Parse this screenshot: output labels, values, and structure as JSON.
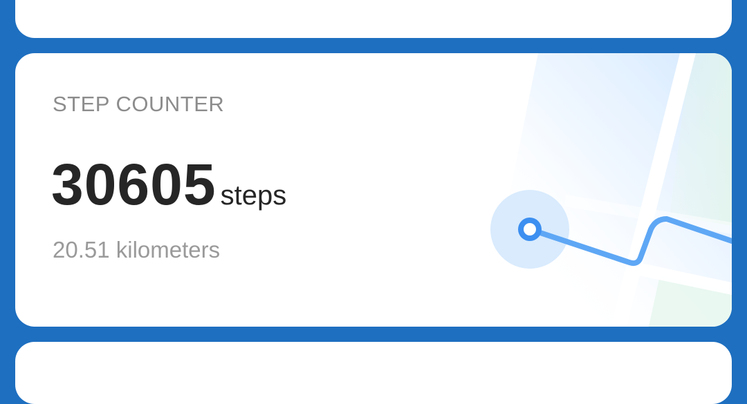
{
  "step_card": {
    "title": "STEP COUNTER",
    "steps": "30605",
    "steps_unit": "steps",
    "distance": "20.51 kilometers"
  },
  "colors": {
    "background": "#1e6fc0",
    "card": "#ffffff",
    "route": "#4a9af0",
    "map_green": "#e6f6ee",
    "map_blue_glow": "#dcecff"
  },
  "icons": {
    "route_start": "location-dot-icon",
    "map": "map-route-illustration"
  }
}
